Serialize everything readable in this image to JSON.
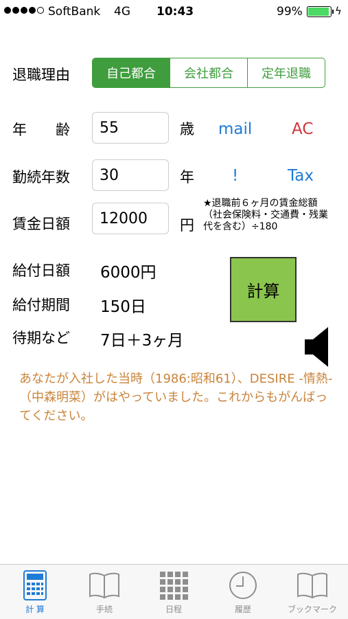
{
  "status_bar": {
    "carrier": "SoftBank",
    "network": "4G",
    "time": "10:43",
    "battery": "99%"
  },
  "form": {
    "reason_label": "退職理由",
    "reason_options": [
      "自己都合",
      "会社都合",
      "定年退職"
    ],
    "reason_selected": "自己都合",
    "age_label": "年　　齢",
    "age_value": "55",
    "age_unit": "歳",
    "years_label": "勤続年数",
    "years_value": "30",
    "years_unit": "年",
    "wage_label": "賃金日額",
    "wage_value": "12000",
    "wage_unit": "円",
    "wage_note": "★退職前６ヶ月の賃金総額（社会保険料・交通費・残業代を含む）÷180"
  },
  "links": {
    "mail": "mail",
    "ac": "AC",
    "exclaim": "!",
    "tax": "Tax"
  },
  "results": {
    "daily_benefit_label": "給付日額",
    "daily_benefit_value": "6000円",
    "period_label": "給付期間",
    "period_value": "150日",
    "waiting_label": "待期など",
    "waiting_value": "7日＋3ヶ月"
  },
  "calc_button": "計算",
  "message": "あなたが入社した当時（1986:昭和61）、DESIRE -情熱-（中森明菜）がはやっていました。これからもがんばってください。",
  "tab_bar": {
    "tabs": [
      {
        "label": "計 算",
        "icon": "calculator-icon",
        "active": true
      },
      {
        "label": "手続",
        "icon": "book-icon",
        "active": false
      },
      {
        "label": "日程",
        "icon": "grid-icon",
        "active": false
      },
      {
        "label": "履歴",
        "icon": "clock-icon",
        "active": false
      },
      {
        "label": "ブックマーク",
        "icon": "bookmark-book-icon",
        "active": false
      }
    ]
  },
  "colors": {
    "accent_green": "#3f9d3d",
    "link_blue": "#1e7bd6",
    "ac_red": "#d0353a",
    "message_orange": "#c9843a",
    "calc_green": "#8ac54d"
  }
}
